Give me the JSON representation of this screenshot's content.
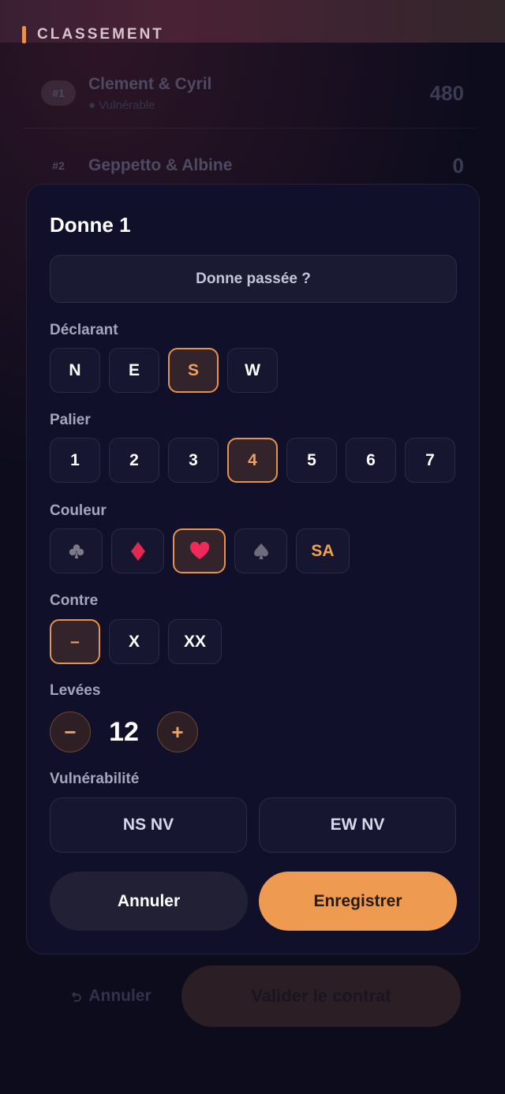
{
  "background": {
    "section_title": "CLASSEMENT",
    "ranking": [
      {
        "rank": "#1",
        "name": "Clement & Cyril",
        "status": "● Vulnérable",
        "score": "480"
      },
      {
        "rank": "#2",
        "name": "Geppetto & Albine",
        "status": "",
        "score": "0"
      }
    ],
    "bottom": {
      "cancel_label": "Annuler",
      "validate_label": "Valider le contrat"
    }
  },
  "modal": {
    "title": "Donne 1",
    "passed_label": "Donne passée ?",
    "declarant": {
      "label": "Déclarant",
      "options": [
        "N",
        "E",
        "S",
        "W"
      ],
      "selected": "S"
    },
    "palier": {
      "label": "Palier",
      "options": [
        "1",
        "2",
        "3",
        "4",
        "5",
        "6",
        "7"
      ],
      "selected": "4"
    },
    "couleur": {
      "label": "Couleur",
      "options": [
        "club-icon",
        "diamond-icon",
        "heart-icon",
        "spade-icon",
        "SA"
      ],
      "selected": "heart-icon",
      "colors": {
        "club": "#7d7a88",
        "diamond": "#e0294f",
        "heart": "#ef2a5a",
        "spade": "#6d6b7c"
      }
    },
    "contre": {
      "label": "Contre",
      "options": [
        "–",
        "X",
        "XX"
      ],
      "selected": "–"
    },
    "levees": {
      "label": "Levées",
      "value": "12",
      "minus": "−",
      "plus": "+"
    },
    "vulnerabilite": {
      "label": "Vulnérabilité",
      "ns": "NS NV",
      "ew": "EW NV"
    },
    "actions": {
      "cancel": "Annuler",
      "save": "Enregistrer"
    },
    "accent": "#ee9a50"
  }
}
